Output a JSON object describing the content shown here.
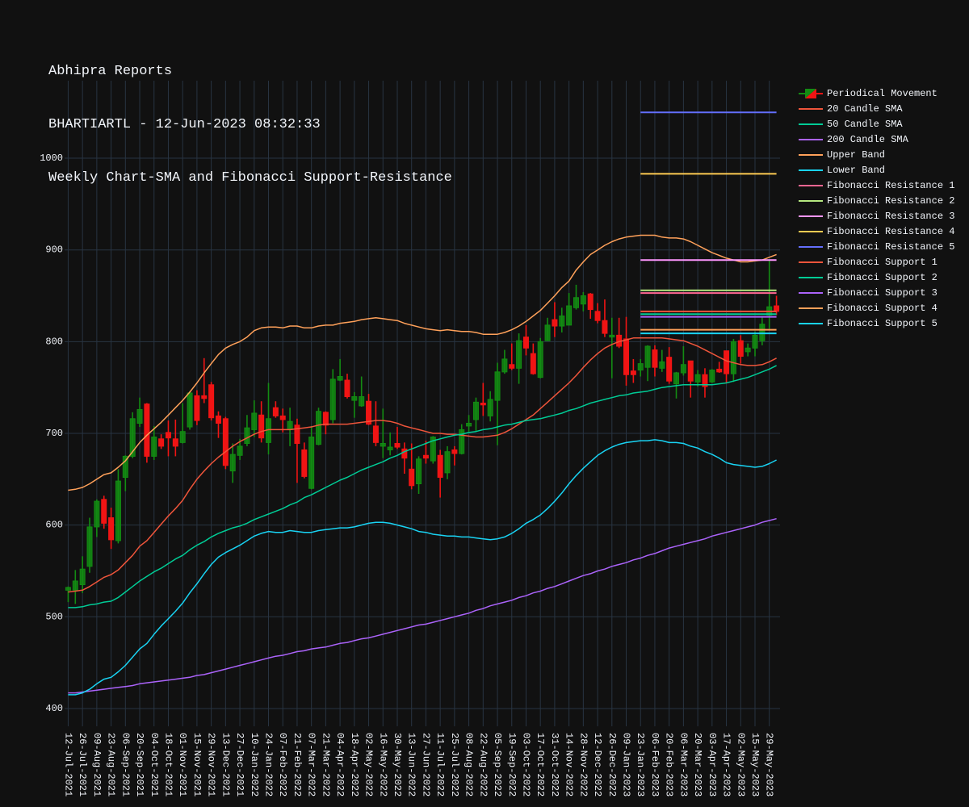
{
  "header": {
    "line1": "Abhipra Reports",
    "line2": "BHARTIARTL - 12-Jun-2023 08:32:33",
    "line3": "Weekly Chart-SMA and Fibonacci Support-Resistance"
  },
  "chart_data": {
    "type": "line",
    "subtype": "candlestick",
    "title": "Abhipra Reports / BHARTIARTL - 12-Jun-2023 08:32:33 / Weekly Chart-SMA and Fibonacci Support-Resistance",
    "xlabel": "",
    "ylabel": "",
    "xlim": [
      -0.5,
      99.5
    ],
    "ylim": [
      380.6,
      1084.5
    ],
    "grid": true,
    "legend_position": "right",
    "x_tick_step": 2,
    "x_tick_labels": [
      "12-Jul-2021",
      "26-Jul-2021",
      "09-Aug-2021",
      "23-Aug-2021",
      "06-Sep-2021",
      "20-Sep-2021",
      "04-Oct-2021",
      "18-Oct-2021",
      "01-Nov-2021",
      "15-Nov-2021",
      "29-Nov-2021",
      "13-Dec-2021",
      "27-Dec-2021",
      "10-Jan-2022",
      "24-Jan-2022",
      "07-Feb-2022",
      "21-Feb-2022",
      "07-Mar-2022",
      "21-Mar-2022",
      "04-Apr-2022",
      "18-Apr-2022",
      "02-May-2022",
      "16-May-2022",
      "30-May-2022",
      "13-Jun-2022",
      "27-Jun-2022",
      "11-Jul-2022",
      "25-Jul-2022",
      "08-Aug-2022",
      "22-Aug-2022",
      "05-Sep-2022",
      "19-Sep-2022",
      "03-Oct-2022",
      "17-Oct-2022",
      "31-Oct-2022",
      "14-Nov-2022",
      "28-Nov-2022",
      "12-Dec-2022",
      "26-Dec-2022",
      "09-Jan-2023",
      "23-Jan-2023",
      "06-Feb-2023",
      "20-Feb-2023",
      "06-Mar-2023",
      "20-Mar-2023",
      "03-Apr-2023",
      "17-Apr-2023",
      "02-May-2023",
      "15-May-2023",
      "29-May-2023"
    ],
    "y_ticks": [
      400,
      500,
      600,
      700,
      800,
      900,
      1000
    ],
    "candles": {
      "name": "Periodical Movement",
      "increasing_color": "#138c13",
      "decreasing_color": "#f01414",
      "open": [
        529,
        529,
        535,
        555,
        598,
        628,
        608,
        583,
        652,
        675,
        711,
        732,
        675,
        694,
        701,
        694,
        690,
        707,
        741,
        741,
        753,
        719,
        716,
        659,
        676,
        689,
        704,
        720,
        690,
        728,
        719,
        704,
        709,
        682,
        640,
        688,
        723,
        715,
        758,
        758,
        736,
        730,
        735,
        708,
        686,
        682,
        689,
        683,
        661,
        645,
        676,
        670,
        676,
        657,
        682,
        678,
        708,
        715,
        733,
        719,
        736,
        767,
        775,
        771,
        805,
        787,
        761,
        801,
        824,
        817,
        818,
        837,
        841,
        852,
        833,
        823,
        805,
        807,
        803,
        768,
        769,
        772,
        791,
        771,
        783,
        754,
        766,
        779,
        756,
        764,
        756,
        770,
        790,
        765,
        801,
        789,
        793,
        801,
        829,
        839
      ],
      "high": [
        533,
        551,
        566,
        608,
        628,
        632,
        619,
        661,
        676,
        723,
        739,
        733,
        708,
        699,
        714,
        715,
        733,
        746,
        747,
        782,
        756,
        724,
        718,
        689,
        694,
        720,
        736,
        735,
        755,
        735,
        727,
        728,
        716,
        690,
        708,
        728,
        724,
        770,
        781,
        765,
        745,
        762,
        743,
        735,
        727,
        701,
        707,
        690,
        689,
        675,
        692,
        697,
        682,
        686,
        686,
        710,
        720,
        739,
        755,
        746,
        777,
        791,
        798,
        809,
        818,
        798,
        804,
        826,
        843,
        837,
        853,
        862,
        854,
        853,
        842,
        846,
        826,
        826,
        827,
        781,
        781,
        796,
        796,
        791,
        794,
        767,
        795,
        779,
        769,
        771,
        770,
        778,
        790,
        803,
        807,
        798,
        811,
        828,
        889,
        850
      ],
      "low": [
        516,
        514,
        526,
        548,
        587,
        596,
        574,
        580,
        637,
        673,
        707,
        668,
        671,
        683,
        675,
        675,
        689,
        704,
        709,
        733,
        714,
        695,
        661,
        646,
        671,
        686,
        696,
        690,
        677,
        717,
        701,
        686,
        646,
        651,
        639,
        687,
        699,
        711,
        757,
        738,
        717,
        729,
        709,
        686,
        673,
        676,
        683,
        656,
        639,
        634,
        667,
        667,
        630,
        650,
        665,
        677,
        702,
        702,
        719,
        713,
        687,
        765,
        769,
        754,
        785,
        764,
        760,
        801,
        805,
        810,
        818,
        835,
        833,
        825,
        820,
        805,
        760,
        793,
        752,
        755,
        762,
        757,
        762,
        767,
        754,
        738,
        763,
        739,
        751,
        739,
        755,
        766,
        755,
        756,
        776,
        784,
        784,
        796,
        814,
        829
      ],
      "close": [
        532,
        539,
        552,
        598,
        626,
        602,
        584,
        648,
        675,
        716,
        726,
        675,
        696,
        686,
        695,
        686,
        702,
        744,
        714,
        738,
        717,
        711,
        665,
        677,
        686,
        706,
        722,
        695,
        716,
        719,
        715,
        713,
        689,
        653,
        696,
        724,
        709,
        759,
        762,
        740,
        740,
        740,
        710,
        690,
        689,
        685,
        685,
        673,
        643,
        672,
        673,
        696,
        652,
        680,
        678,
        704,
        711,
        734,
        731,
        737,
        767,
        781,
        771,
        801,
        793,
        765,
        800,
        818,
        817,
        828,
        839,
        848,
        850,
        835,
        823,
        809,
        807,
        795,
        764,
        764,
        776,
        795,
        772,
        778,
        757,
        766,
        775,
        757,
        764,
        751,
        769,
        767,
        765,
        800,
        784,
        793,
        807,
        819,
        838,
        833
      ]
    },
    "series": [
      {
        "name": "20 Candle SMA",
        "color": "#EF553B",
        "values": [
          527,
          528,
          529,
          533,
          538,
          543,
          546,
          551,
          559,
          567,
          577,
          583,
          592,
          601,
          610,
          618,
          627,
          639,
          650,
          659,
          667,
          674,
          680,
          686,
          691,
          695,
          699,
          702,
          704,
          704,
          704,
          704,
          705,
          706,
          707,
          709,
          710,
          710,
          710,
          710,
          711,
          712,
          713,
          714,
          714,
          713,
          711,
          708,
          706,
          704,
          702,
          700,
          700,
          699,
          699,
          698,
          697,
          696,
          696,
          697,
          698,
          701,
          705,
          710,
          715,
          720,
          727,
          734,
          741,
          748,
          755,
          763,
          772,
          780,
          787,
          793,
          797,
          800,
          802,
          804,
          804,
          804,
          804,
          804,
          803,
          802,
          801,
          798,
          795,
          791,
          787,
          783,
          779,
          777,
          775,
          774,
          774,
          775,
          778,
          782
        ]
      },
      {
        "name": "50 Candle SMA",
        "color": "#00CC96",
        "values": [
          510,
          510,
          511,
          513,
          514,
          516,
          517,
          521,
          527,
          533,
          539,
          544,
          549,
          553,
          558,
          563,
          567,
          573,
          578,
          582,
          587,
          591,
          594,
          597,
          599,
          602,
          606,
          609,
          612,
          615,
          618,
          622,
          625,
          630,
          633,
          637,
          641,
          645,
          649,
          652,
          656,
          660,
          663,
          666,
          669,
          673,
          676,
          680,
          683,
          686,
          689,
          692,
          694,
          696,
          698,
          699,
          701,
          702,
          704,
          705,
          707,
          709,
          710,
          712,
          714,
          715,
          716,
          718,
          720,
          722,
          725,
          727,
          730,
          733,
          735,
          737,
          739,
          741,
          742,
          744,
          745,
          746,
          748,
          750,
          751,
          752,
          753,
          753,
          753,
          753,
          753,
          754,
          755,
          757,
          759,
          761,
          764,
          767,
          770,
          774
        ]
      },
      {
        "name": "200 Candle SMA",
        "color": "#AB63FA",
        "values": [
          417,
          417,
          418,
          419,
          420,
          421,
          422,
          423,
          424,
          425,
          427,
          428,
          429,
          430,
          431,
          432,
          433,
          434,
          436,
          437,
          439,
          441,
          443,
          445,
          447,
          449,
          451,
          453,
          455,
          457,
          458,
          460,
          462,
          463,
          465,
          466,
          467,
          469,
          471,
          472,
          474,
          476,
          477,
          479,
          481,
          483,
          485,
          487,
          489,
          491,
          492,
          494,
          496,
          498,
          500,
          502,
          504,
          507,
          509,
          512,
          514,
          516,
          518,
          521,
          523,
          526,
          528,
          531,
          533,
          536,
          539,
          542,
          545,
          547,
          550,
          552,
          555,
          557,
          559,
          562,
          564,
          567,
          569,
          572,
          575,
          577,
          579,
          581,
          583,
          585,
          588,
          590,
          592,
          594,
          596,
          598,
          600,
          603,
          605,
          607
        ]
      },
      {
        "name": "Upper Band",
        "color": "#FFA15A",
        "values": [
          638,
          639,
          641,
          645,
          650,
          655,
          657,
          663,
          670,
          680,
          690,
          698,
          705,
          712,
          720,
          728,
          736,
          745,
          755,
          766,
          776,
          786,
          793,
          797,
          800,
          805,
          812,
          815,
          816,
          816,
          815,
          817,
          817,
          815,
          815,
          817,
          818,
          818,
          820,
          821,
          822,
          824,
          825,
          826,
          825,
          824,
          823,
          820,
          818,
          816,
          814,
          813,
          812,
          813,
          812,
          811,
          811,
          810,
          808,
          808,
          808,
          810,
          813,
          817,
          822,
          828,
          834,
          842,
          850,
          859,
          866,
          878,
          887,
          895,
          900,
          905,
          909,
          912,
          914,
          915,
          916,
          916,
          916,
          914,
          913,
          913,
          912,
          909,
          905,
          901,
          897,
          894,
          891,
          889,
          887,
          887,
          888,
          889,
          892,
          895
        ]
      },
      {
        "name": "Lower Band",
        "color": "#19D3F3",
        "values": [
          415,
          415,
          417,
          421,
          427,
          432,
          434,
          440,
          447,
          456,
          465,
          471,
          481,
          490,
          498,
          506,
          515,
          526,
          536,
          547,
          557,
          565,
          570,
          574,
          578,
          583,
          588,
          591,
          593,
          592,
          592,
          594,
          593,
          592,
          592,
          594,
          595,
          596,
          597,
          597,
          598,
          600,
          602,
          603,
          603,
          602,
          600,
          598,
          596,
          593,
          592,
          590,
          589,
          588,
          588,
          587,
          587,
          586,
          585,
          584,
          585,
          587,
          591,
          596,
          602,
          606,
          611,
          618,
          626,
          635,
          645,
          654,
          662,
          669,
          676,
          681,
          685,
          688,
          690,
          691,
          692,
          692,
          693,
          692,
          690,
          690,
          689,
          686,
          684,
          680,
          677,
          673,
          668,
          666,
          665,
          664,
          663,
          664,
          667,
          671
        ]
      }
    ],
    "fibonacci": [
      {
        "name": "Fibonacci Resistance 1",
        "color": "#FF6692",
        "value": 853,
        "from_index": 80,
        "to_index": 99
      },
      {
        "name": "Fibonacci Resistance 2",
        "color": "#B6E880",
        "value": 856,
        "from_index": 80,
        "to_index": 99
      },
      {
        "name": "Fibonacci Resistance 3",
        "color": "#FF97FF",
        "value": 889,
        "from_index": 80,
        "to_index": 99
      },
      {
        "name": "Fibonacci Resistance 4",
        "color": "#FECB52",
        "value": 983,
        "from_index": 80,
        "to_index": 99
      },
      {
        "name": "Fibonacci Resistance 5",
        "color": "#636EFA",
        "value": 1050,
        "from_index": 80,
        "to_index": 99
      },
      {
        "name": "Fibonacci Support 1",
        "color": "#EF553B",
        "value": 833,
        "from_index": 80,
        "to_index": 99
      },
      {
        "name": "Fibonacci Support 2",
        "color": "#00CC96",
        "value": 830,
        "from_index": 80,
        "to_index": 99
      },
      {
        "name": "Fibonacci Support 3",
        "color": "#AB63FA",
        "value": 827,
        "from_index": 80,
        "to_index": 99
      },
      {
        "name": "Fibonacci Support 4",
        "color": "#FFA15A",
        "value": 813,
        "from_index": 80,
        "to_index": 99
      },
      {
        "name": "Fibonacci Support 5",
        "color": "#19D3F3",
        "value": 809,
        "from_index": 80,
        "to_index": 99
      }
    ]
  }
}
